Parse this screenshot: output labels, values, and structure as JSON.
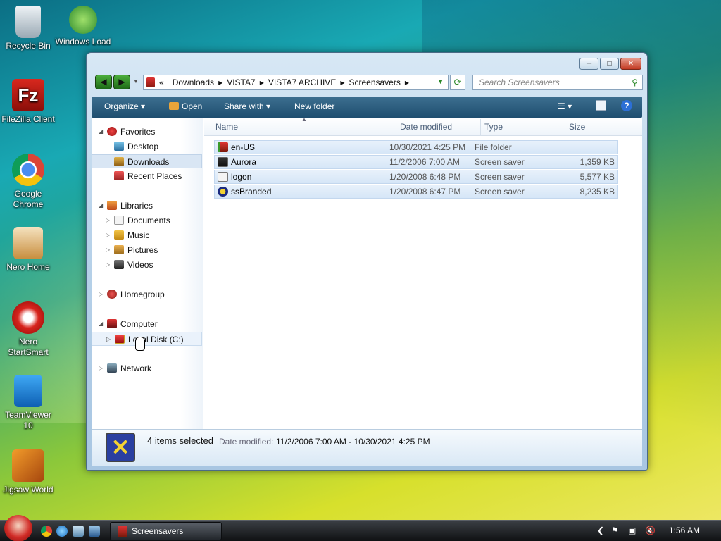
{
  "desktop": {
    "icons": [
      {
        "label": "Recycle Bin"
      },
      {
        "label": "Windows Load"
      },
      {
        "label": "FileZilla Client"
      },
      {
        "label": "Google Chrome"
      },
      {
        "label": "Nero Home"
      },
      {
        "label": "Nero StartSmart"
      },
      {
        "label": "TeamViewer 10"
      },
      {
        "label": "Jigsaw World"
      }
    ]
  },
  "window": {
    "address": {
      "overflow": "«",
      "segments": [
        "Downloads",
        "VISTA7",
        "VISTA7 ARCHIVE",
        "Screensavers"
      ]
    },
    "search_placeholder": "Search Screensavers",
    "toolbar": {
      "organize": "Organize",
      "open": "Open",
      "share": "Share with",
      "new_folder": "New folder"
    },
    "nav": {
      "favorites": "Favorites",
      "desktop": "Desktop",
      "downloads": "Downloads",
      "recent": "Recent Places",
      "libraries": "Libraries",
      "documents": "Documents",
      "music": "Music",
      "pictures": "Pictures",
      "videos": "Videos",
      "homegroup": "Homegroup",
      "computer": "Computer",
      "local_disk": "Local Disk (C:)",
      "network": "Network"
    },
    "columns": {
      "name": "Name",
      "date": "Date modified",
      "type": "Type",
      "size": "Size"
    },
    "files": [
      {
        "name": "en-US",
        "date": "10/30/2021 4:25 PM",
        "type": "File folder",
        "size": ""
      },
      {
        "name": "Aurora",
        "date": "11/2/2006 7:00 AM",
        "type": "Screen saver",
        "size": "1,359 KB"
      },
      {
        "name": "logon",
        "date": "1/20/2008 6:48 PM",
        "type": "Screen saver",
        "size": "5,577 KB"
      },
      {
        "name": "ssBranded",
        "date": "1/20/2008 6:47 PM",
        "type": "Screen saver",
        "size": "8,235 KB"
      }
    ],
    "details": {
      "count": "4 items selected",
      "date_label": "Date modified:",
      "date_range": "11/2/2006 7:00 AM - 10/30/2021 4:25 PM"
    }
  },
  "taskbar": {
    "task_label": "Screensavers",
    "clock": "1:56 AM"
  }
}
